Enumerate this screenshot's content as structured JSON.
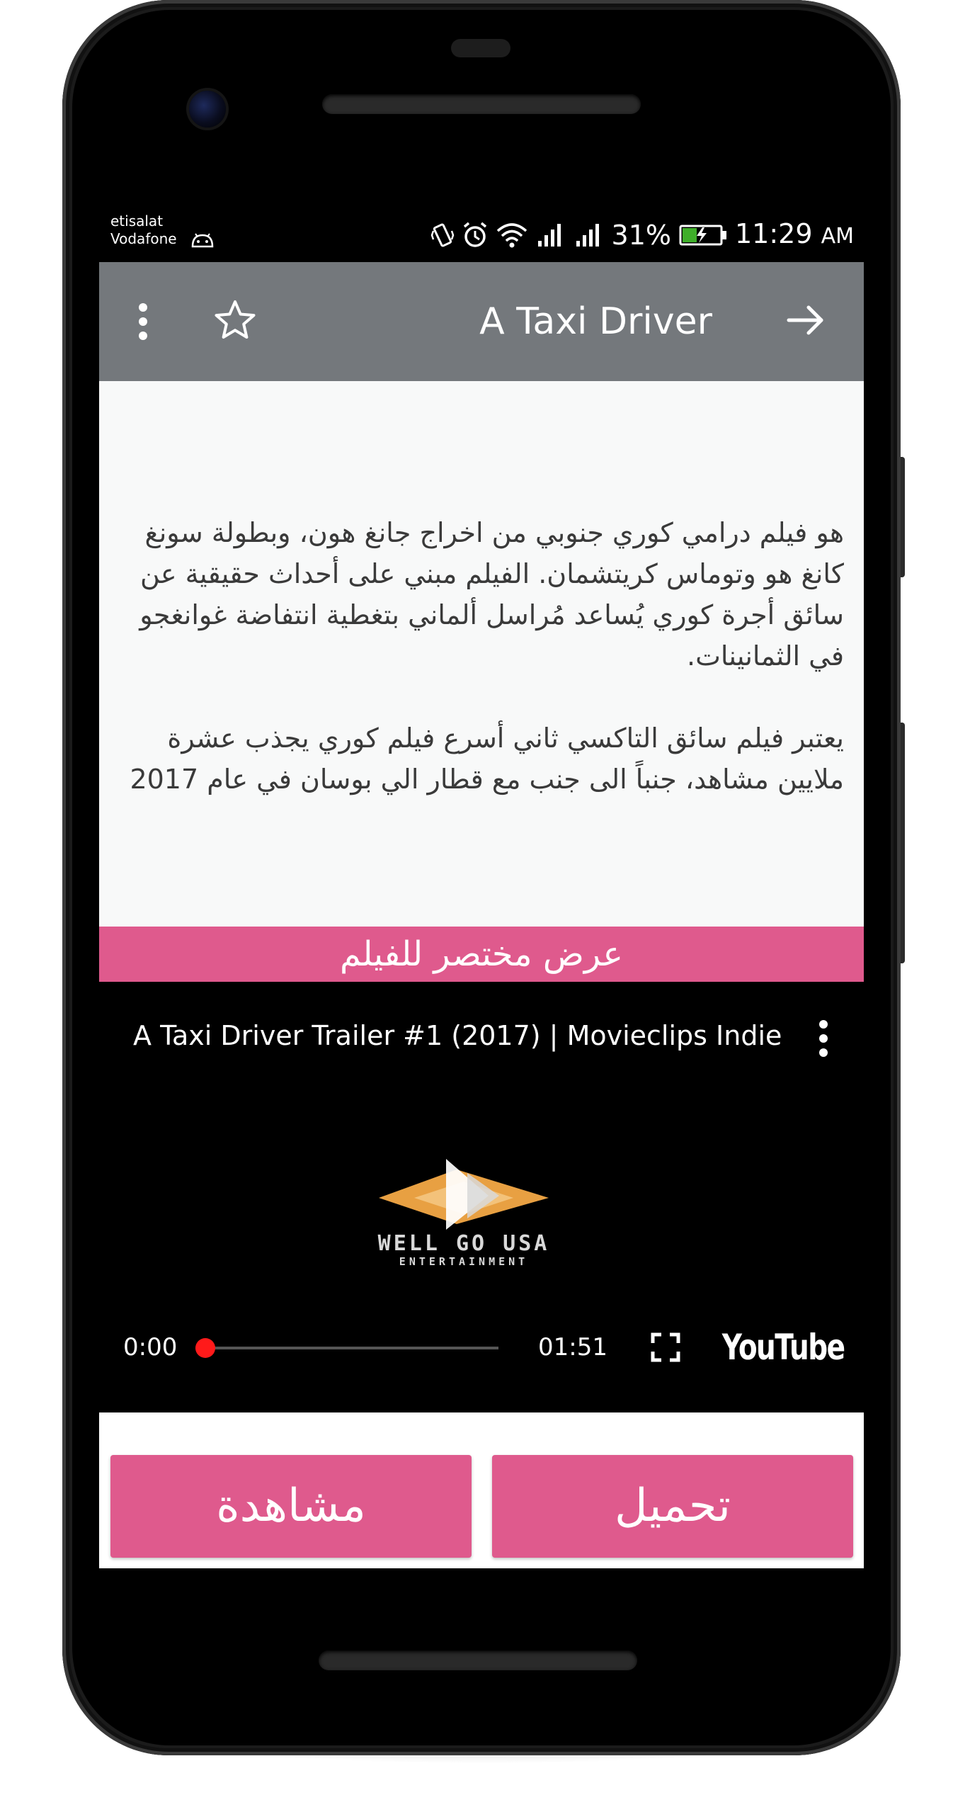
{
  "status_bar": {
    "carrier_line1": "etisalat",
    "carrier_line2": "Vodafone",
    "battery": "31%",
    "time": "11:29",
    "ampm": "AM"
  },
  "app_bar": {
    "title": "A Taxi Driver"
  },
  "description": {
    "paragraph1": "هو فيلم درامي كوري جنوبي من اخراج جانغ هون، وبطولة سونغ كانغ هو وتوماس كريتشمان. الفيلم مبني على أحداث حقيقية عن سائق أجرة كوري يُساعد مُراسل ألماني بتغطية انتفاضة غوانغجو في الثمانينات.",
    "paragraph2": "يعتبر فيلم سائق التاكسي ثاني أسرع فيلم كوري يجذب عشرة ملايين مشاهد، جنباً الى جنب مع قطار الي بوسان في عام 2017"
  },
  "section": {
    "trailer_header": "عرض مختصر للفيلم"
  },
  "video": {
    "title": "A Taxi Driver Trailer #1 (2017) | Movieclips Indie",
    "logo_line1": "WELL GO USA",
    "logo_line2": "ENTERTAINMENT",
    "current_time": "0:00",
    "duration": "01:51",
    "progress": 0,
    "provider": "YouTube"
  },
  "actions": {
    "watch_label": "مشاهدة",
    "download_label": "تحميل"
  },
  "colors": {
    "accent": "#df5a8d",
    "app_bar": "#74787c",
    "progress": "#ff1a1a"
  }
}
